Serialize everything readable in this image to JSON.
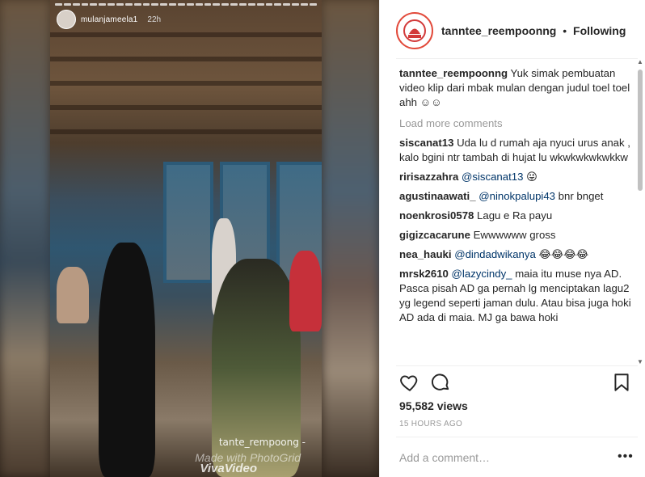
{
  "story": {
    "username": "mulanjameela1",
    "time": "22h"
  },
  "watermark": {
    "handle": "tante_rempoong -",
    "app1": "Made with PhotoGrid",
    "app2": "VivaVideo"
  },
  "header": {
    "username": "tanntee_reempoonng",
    "separator": "•",
    "follow_status": "Following"
  },
  "caption": {
    "username": "tanntee_reempoonng",
    "text": "Yuk simak pembuatan video klip dari mbak mulan dengan judul toel toel ahh ☺☺"
  },
  "load_more": "Load more comments",
  "comments": [
    {
      "user": "siscanat13",
      "mention": "",
      "text": "Uda lu d rumah aja nyuci urus anak , kalo bgini ntr tambah di hujat lu wkwkwkwkwkkw"
    },
    {
      "user": "ririsazzahra",
      "mention": "@siscanat13",
      "text": "😜"
    },
    {
      "user": "agustinaawati_",
      "mention": "@ninokpalupi43",
      "text": "bnr bnget"
    },
    {
      "user": "noenkrosi0578",
      "mention": "",
      "text": "Lagu e Ra payu"
    },
    {
      "user": "gigizcacarune",
      "mention": "",
      "text": "Ewwwwww gross"
    },
    {
      "user": "nea_hauki",
      "mention": "@dindadwikanya",
      "text": "😂😂😂😂"
    },
    {
      "user": "mrsk2610",
      "mention": "@lazycindy_",
      "text": "maia itu muse nya AD. Pasca pisah AD ga pernah lg menciptakan lagu2 yg legend seperti jaman dulu. Atau bisa juga hoki AD ada di maia. MJ ga bawa hoki"
    }
  ],
  "stats": {
    "views": "95,582 views",
    "time_ago": "15 HOURS AGO"
  },
  "add_comment": {
    "placeholder": "Add a comment…",
    "more": "•••"
  },
  "icons": {
    "like": "heart-icon",
    "comment": "comment-icon",
    "save": "bookmark-icon"
  },
  "colors": {
    "mention": "#003569",
    "muted": "#999999",
    "text": "#262626",
    "avatar_ring": "#e24a3b"
  }
}
